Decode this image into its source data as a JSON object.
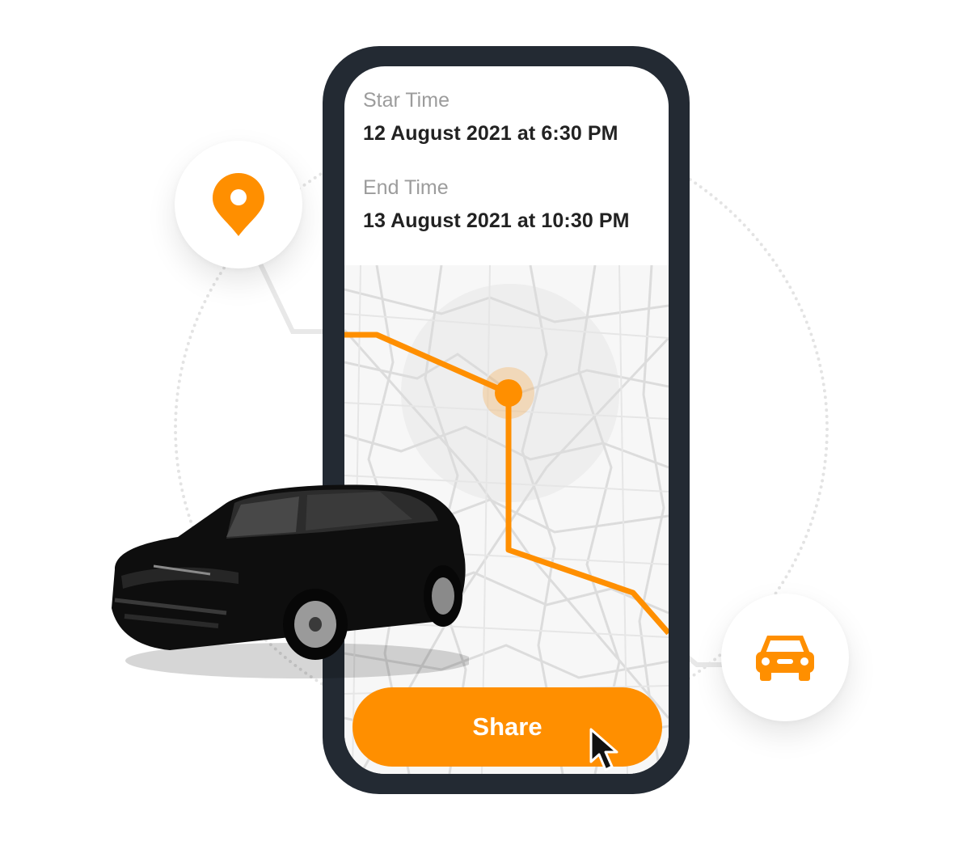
{
  "trip": {
    "start_label": "Star Time",
    "start_value": "12 August 2021 at 6:30 PM",
    "end_label": "End Time",
    "end_value": "13 August 2021 at 10:30 PM"
  },
  "actions": {
    "share_label": "Share"
  },
  "icons": {
    "start_marker": "location-pin-icon",
    "end_marker": "car-icon",
    "pointer": "mouse-cursor-icon",
    "vehicle": "car-illustration"
  },
  "colors": {
    "accent": "#ff8f00",
    "phone_frame": "#232a33",
    "label_gray": "#9c9c9c",
    "value_dark": "#222222"
  }
}
